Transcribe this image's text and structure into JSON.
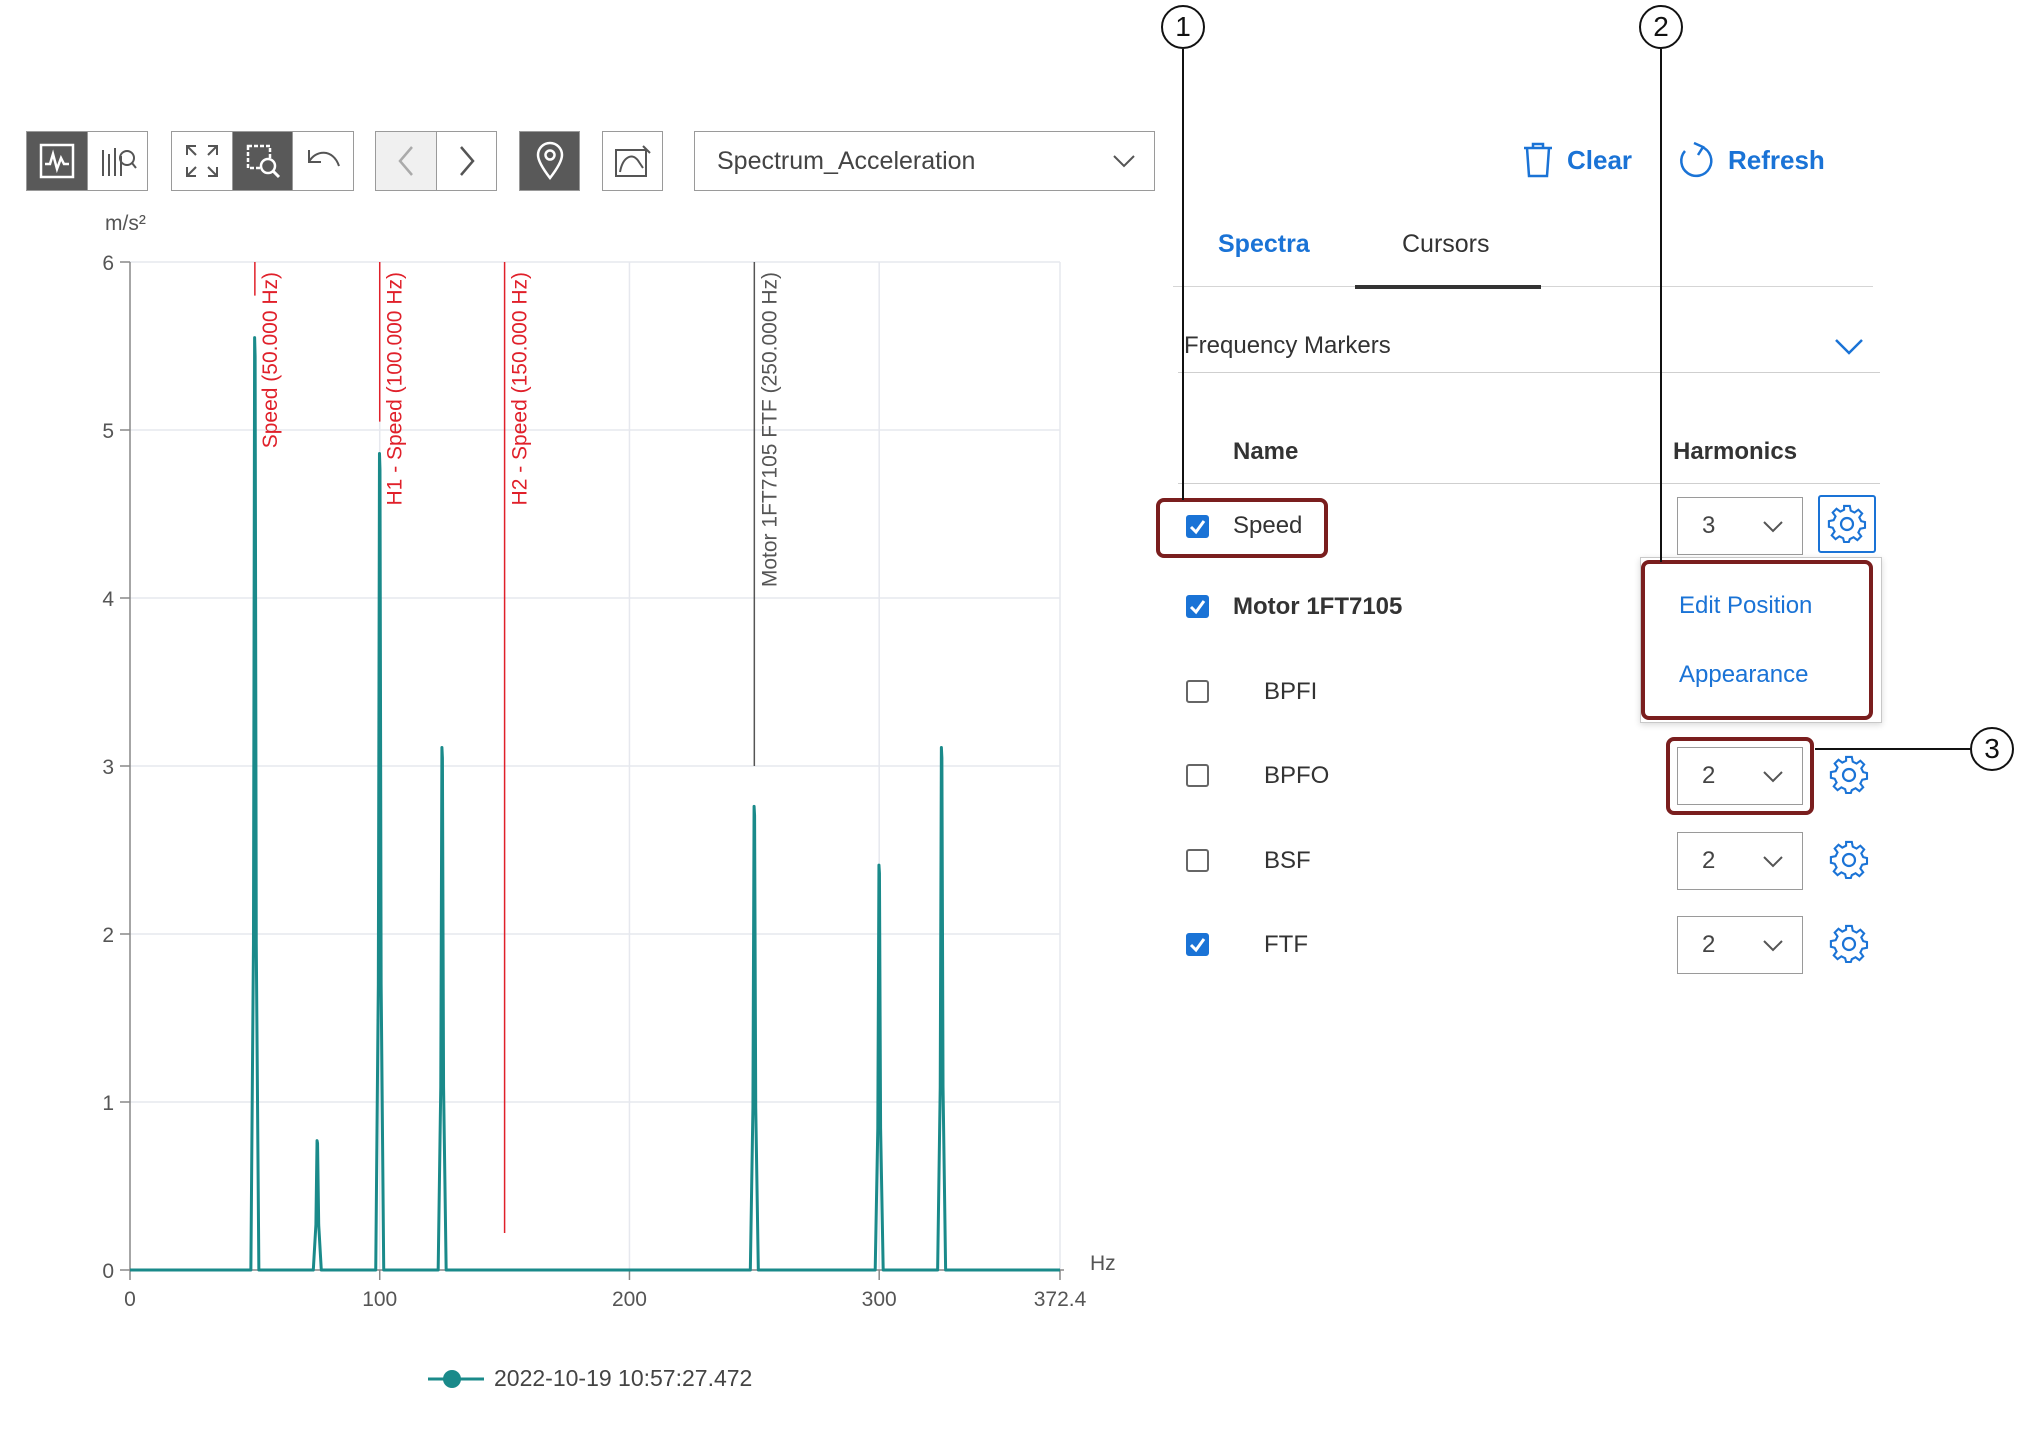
{
  "toolbar": {
    "view_buttons": [
      {
        "icon": "waveform-icon",
        "active": true
      },
      {
        "icon": "spectrum-analysis-icon",
        "active": false
      }
    ],
    "zoom_buttons": [
      {
        "icon": "zoom-fit-icon",
        "active": false
      },
      {
        "icon": "zoom-box-icon",
        "active": true
      },
      {
        "icon": "undo-zoom-icon",
        "active": false
      }
    ],
    "nav_buttons": [
      {
        "icon": "chevron-left-icon",
        "disabled": true
      },
      {
        "icon": "chevron-right-icon",
        "disabled": false
      }
    ],
    "marker_button": {
      "icon": "location-pin-icon",
      "active": true
    },
    "shape_button": {
      "icon": "shape-select-icon"
    },
    "signal_select": {
      "value": "Spectrum_Acceleration"
    }
  },
  "actions": {
    "clear_label": "Clear",
    "refresh_label": "Refresh"
  },
  "tabs": [
    {
      "label": "Spectra",
      "active": false
    },
    {
      "label": "Cursors",
      "active": true
    }
  ],
  "panel": {
    "section_title": "Frequency Markers",
    "col_name": "Name",
    "col_harmonics": "Harmonics",
    "rows": [
      {
        "label": "Speed",
        "checked": true,
        "harmonics": "3",
        "bold": false,
        "indent": false
      },
      {
        "label": "Motor 1FT7105",
        "checked": true,
        "harmonics": null,
        "bold": true,
        "indent": false
      },
      {
        "label": "BPFI",
        "checked": false,
        "harmonics": null,
        "bold": false,
        "indent": true
      },
      {
        "label": "BPFO",
        "checked": false,
        "harmonics": "2",
        "bold": false,
        "indent": true
      },
      {
        "label": "BSF",
        "checked": false,
        "harmonics": "2",
        "bold": false,
        "indent": true
      },
      {
        "label": "FTF",
        "checked": true,
        "harmonics": "2",
        "bold": false,
        "indent": true
      }
    ],
    "context_menu": [
      "Edit Position",
      "Appearance"
    ]
  },
  "callouts": [
    "1",
    "2",
    "3"
  ],
  "colors": {
    "accent": "#1a73d6",
    "series": "#1a8a8a",
    "marker_red": "#e0202a",
    "marker_gray": "#555555",
    "highlight": "#7a1e1e"
  },
  "chart_data": {
    "type": "line",
    "unit_label": "m/s²",
    "x_unit_label": "Hz",
    "xlim": [
      0,
      372.4
    ],
    "ylim": [
      0,
      6
    ],
    "x_ticks": [
      "0",
      "100",
      "200",
      "300",
      "372.4"
    ],
    "y_ticks": [
      "0",
      "1",
      "2",
      "3",
      "4",
      "5",
      "6"
    ],
    "grid": true,
    "series": [
      {
        "name": "2022-10-19 10:57:27.472",
        "peaks": [
          {
            "x": 50,
            "y": 5.55
          },
          {
            "x": 75,
            "y": 0.77
          },
          {
            "x": 100,
            "y": 4.86
          },
          {
            "x": 125,
            "y": 3.11
          },
          {
            "x": 250,
            "y": 2.76
          },
          {
            "x": 300,
            "y": 2.41
          },
          {
            "x": 325,
            "y": 3.11
          }
        ]
      }
    ],
    "markers": [
      {
        "x": 50,
        "label": "Speed (50.000 Hz)",
        "color": "red",
        "y_top": 6.0,
        "y_bottom": 5.8
      },
      {
        "x": 100,
        "label": "H1 - Speed (100.000 Hz)",
        "color": "red",
        "y_top": 6.0,
        "y_bottom": 5.05
      },
      {
        "x": 150,
        "label": "H2 - Speed (150.000 Hz)",
        "color": "red",
        "y_top": 6.0,
        "y_bottom": 0.22
      },
      {
        "x": 250,
        "label": "Motor 1FT7105 FTF (250.000 Hz)",
        "color": "gray",
        "y_top": 6.0,
        "y_bottom": 3.0
      }
    ],
    "legend": {
      "label": "2022-10-19 10:57:27.472",
      "position": "bottom-center"
    }
  }
}
